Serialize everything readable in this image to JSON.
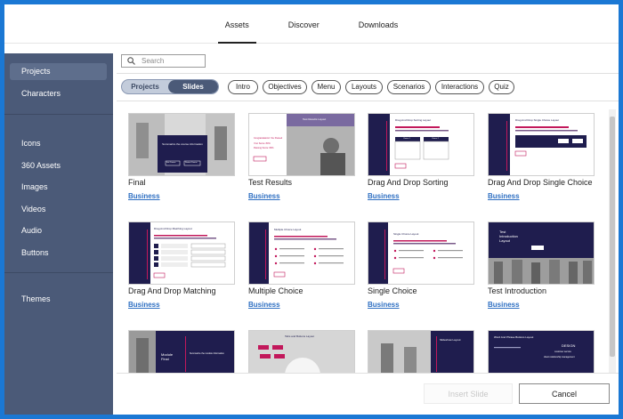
{
  "topnav": {
    "tabs": [
      "Assets",
      "Discover",
      "Downloads"
    ],
    "active": 0
  },
  "sidebar": {
    "groups": [
      [
        "Projects",
        "Characters"
      ],
      [
        "Icons",
        "360 Assets",
        "Images",
        "Videos",
        "Audio",
        "Buttons"
      ],
      [
        "Themes"
      ]
    ],
    "active": "Projects"
  },
  "search": {
    "placeholder": "Search"
  },
  "toggle": {
    "projects": "Projects",
    "slides": "Slides",
    "selected": "Slides"
  },
  "filters": [
    "Intro",
    "Objectives",
    "Menu",
    "Layouts",
    "Scenarios",
    "Interactions",
    "Quiz"
  ],
  "cards": [
    {
      "title": "Final",
      "tag": "Business"
    },
    {
      "title": "Test Results",
      "tag": "Business"
    },
    {
      "title": "Drag And Drop Sorting",
      "tag": "Business"
    },
    {
      "title": "Drag And Drop Single Choice",
      "tag": "Business"
    },
    {
      "title": "Drag And Drop Matching",
      "tag": "Business"
    },
    {
      "title": "Multiple Choice",
      "tag": "Business"
    },
    {
      "title": "Single Choice",
      "tag": "Business"
    },
    {
      "title": "Test Introduction",
      "tag": "Business"
    },
    {
      "title": "",
      "tag": ""
    },
    {
      "title": "",
      "tag": ""
    },
    {
      "title": "",
      "tag": ""
    },
    {
      "title": "",
      "tag": ""
    }
  ],
  "thumb_text": {
    "final_head": "Summarize the course information",
    "final_btn1": "Exit Course",
    "final_btn2": "Restart Course",
    "results_head": "Test Results Layout",
    "results_red1": "Congratulations! You Passed",
    "results_red2": "Your Score: 80%",
    "results_red3": "Passing Score: 80%",
    "sorting_head": "Drag And Drop Sorting Layout",
    "sorting_col1": "Choice 1",
    "sorting_col2": "Choice 2",
    "single_dd_head": "Drag And Drop Single Choice Layout",
    "matching_head": "Drag And Drop Matching Layout",
    "mc_head": "Multiple Choice Layout",
    "sc_head": "Single Choice Layout",
    "intro_head1": "Test",
    "intro_head2": "Introduction",
    "intro_head3": "Layout",
    "row3a_1": "Module",
    "row3a_2": "Final",
    "row3a_3": "Summarize the module information",
    "row3b_head": "Tabs and Buttons Layout",
    "row3c_head": "Slideshow Layout",
    "row3d_head": "Word And Phrase Buttons Layout",
    "row3d_big": "DESIGN",
    "row3d_sub1": "customer service",
    "row3d_sub2": "client relationship management"
  },
  "footer": {
    "insert": "Insert Slide",
    "cancel": "Cancel"
  },
  "colors": {
    "window_border": "#1b78d4",
    "sidebar": "#4b5a78",
    "navy": "#1f1d4e",
    "accent_red": "#c2185b",
    "link": "#2e6fc2"
  }
}
